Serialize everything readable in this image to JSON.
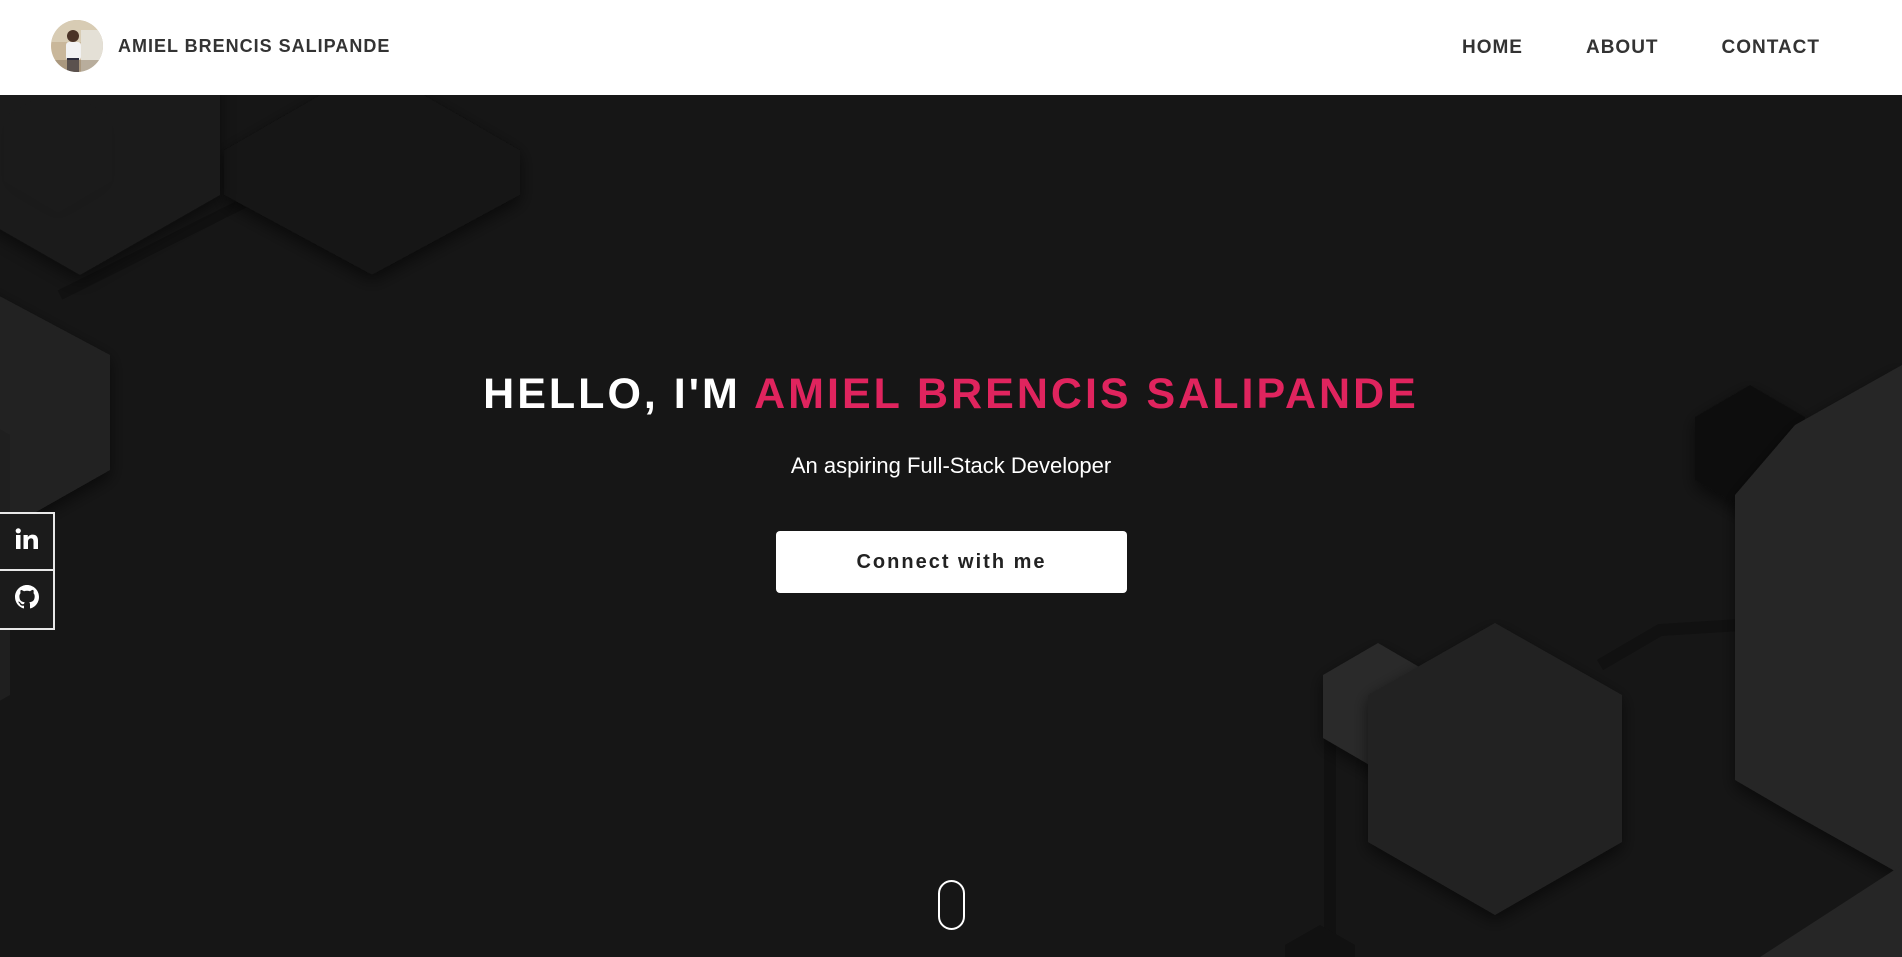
{
  "header": {
    "brand_name": "AMIEL BRENCIS SALIPANDE",
    "nav": [
      {
        "label": "HOME"
      },
      {
        "label": "ABOUT"
      },
      {
        "label": "CONTACT"
      }
    ]
  },
  "hero": {
    "title_prefix": "HELLO, I'M ",
    "title_name": "AMIEL BRENCIS SALIPANDE",
    "subtitle": "An aspiring Full-Stack Developer",
    "cta_label": "Connect with me"
  },
  "social": [
    {
      "icon": "linkedin-icon"
    },
    {
      "icon": "github-icon"
    }
  ],
  "colors": {
    "accent": "#e0245e",
    "background": "#161616",
    "header_bg": "#ffffff",
    "nav_text": "#333333"
  }
}
